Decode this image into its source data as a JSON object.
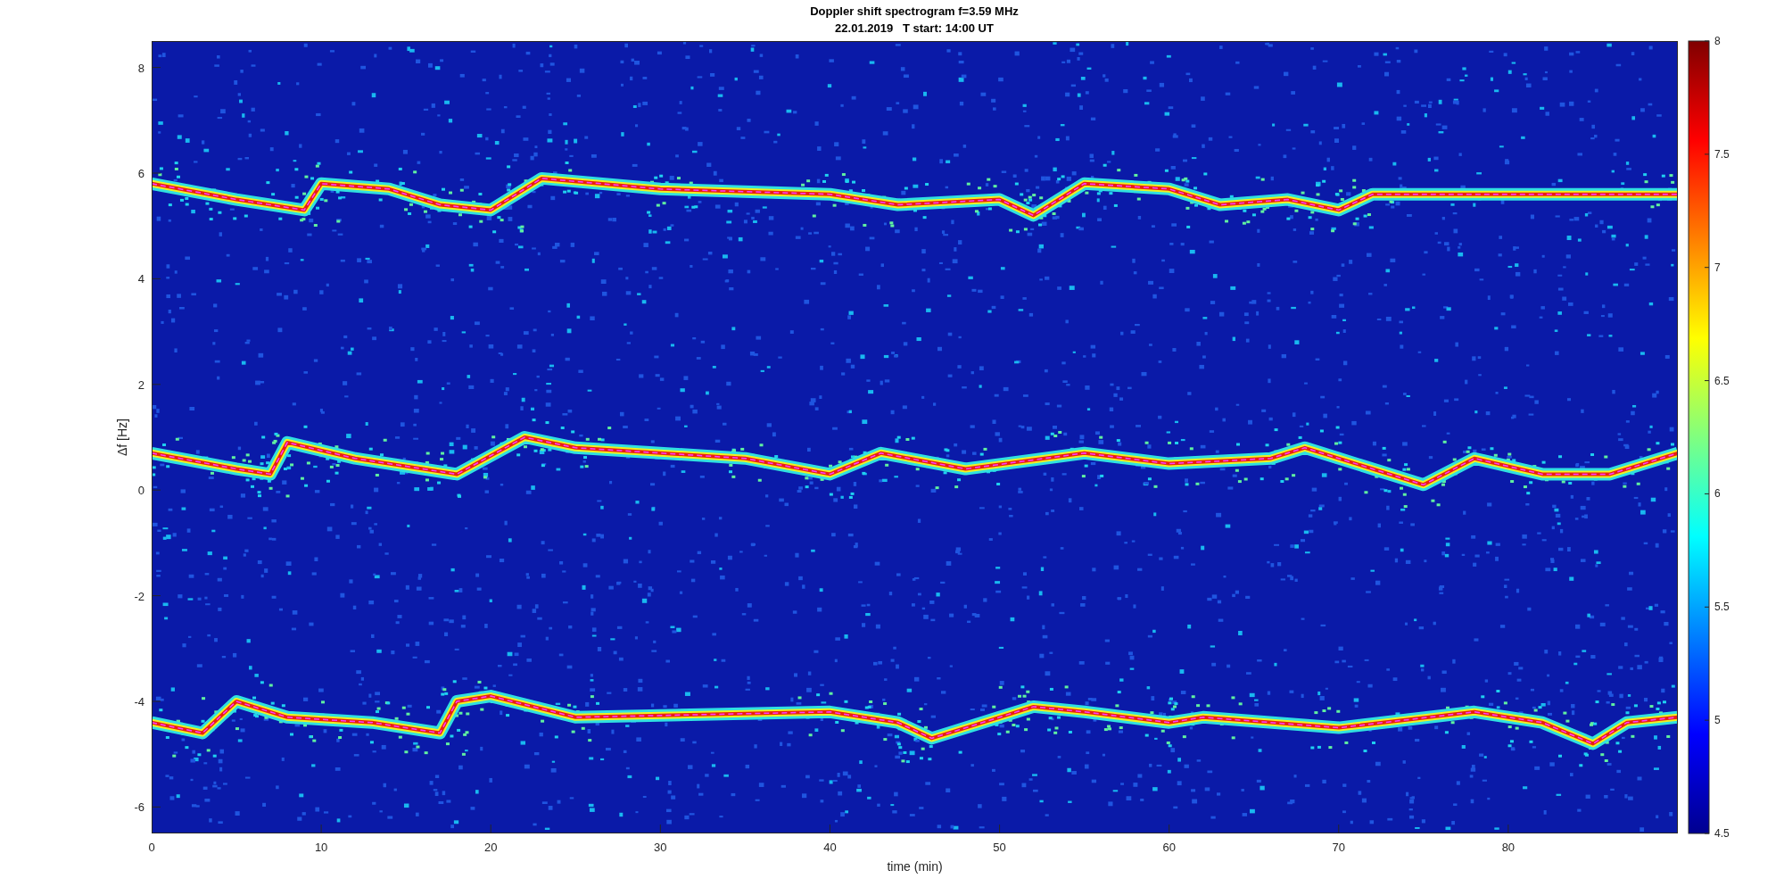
{
  "figure": {
    "title": "Doppler shift spectrogram f=3.59 MHz",
    "subtitle": "22.01.2019   T start: 14:00 UT",
    "xlabel": "time (min)",
    "ylabel": "Δf [Hz]",
    "xticks": [
      "0",
      "10",
      "20",
      "30",
      "40",
      "50",
      "60",
      "70",
      "80"
    ],
    "yticks": [
      "8",
      "6",
      "4",
      "2",
      "0",
      "-2",
      "-4",
      "-6"
    ],
    "colorbar_ticks": [
      "8",
      "7.5",
      "7",
      "6.5",
      "6",
      "5.5",
      "5",
      "4.5"
    ]
  }
}
